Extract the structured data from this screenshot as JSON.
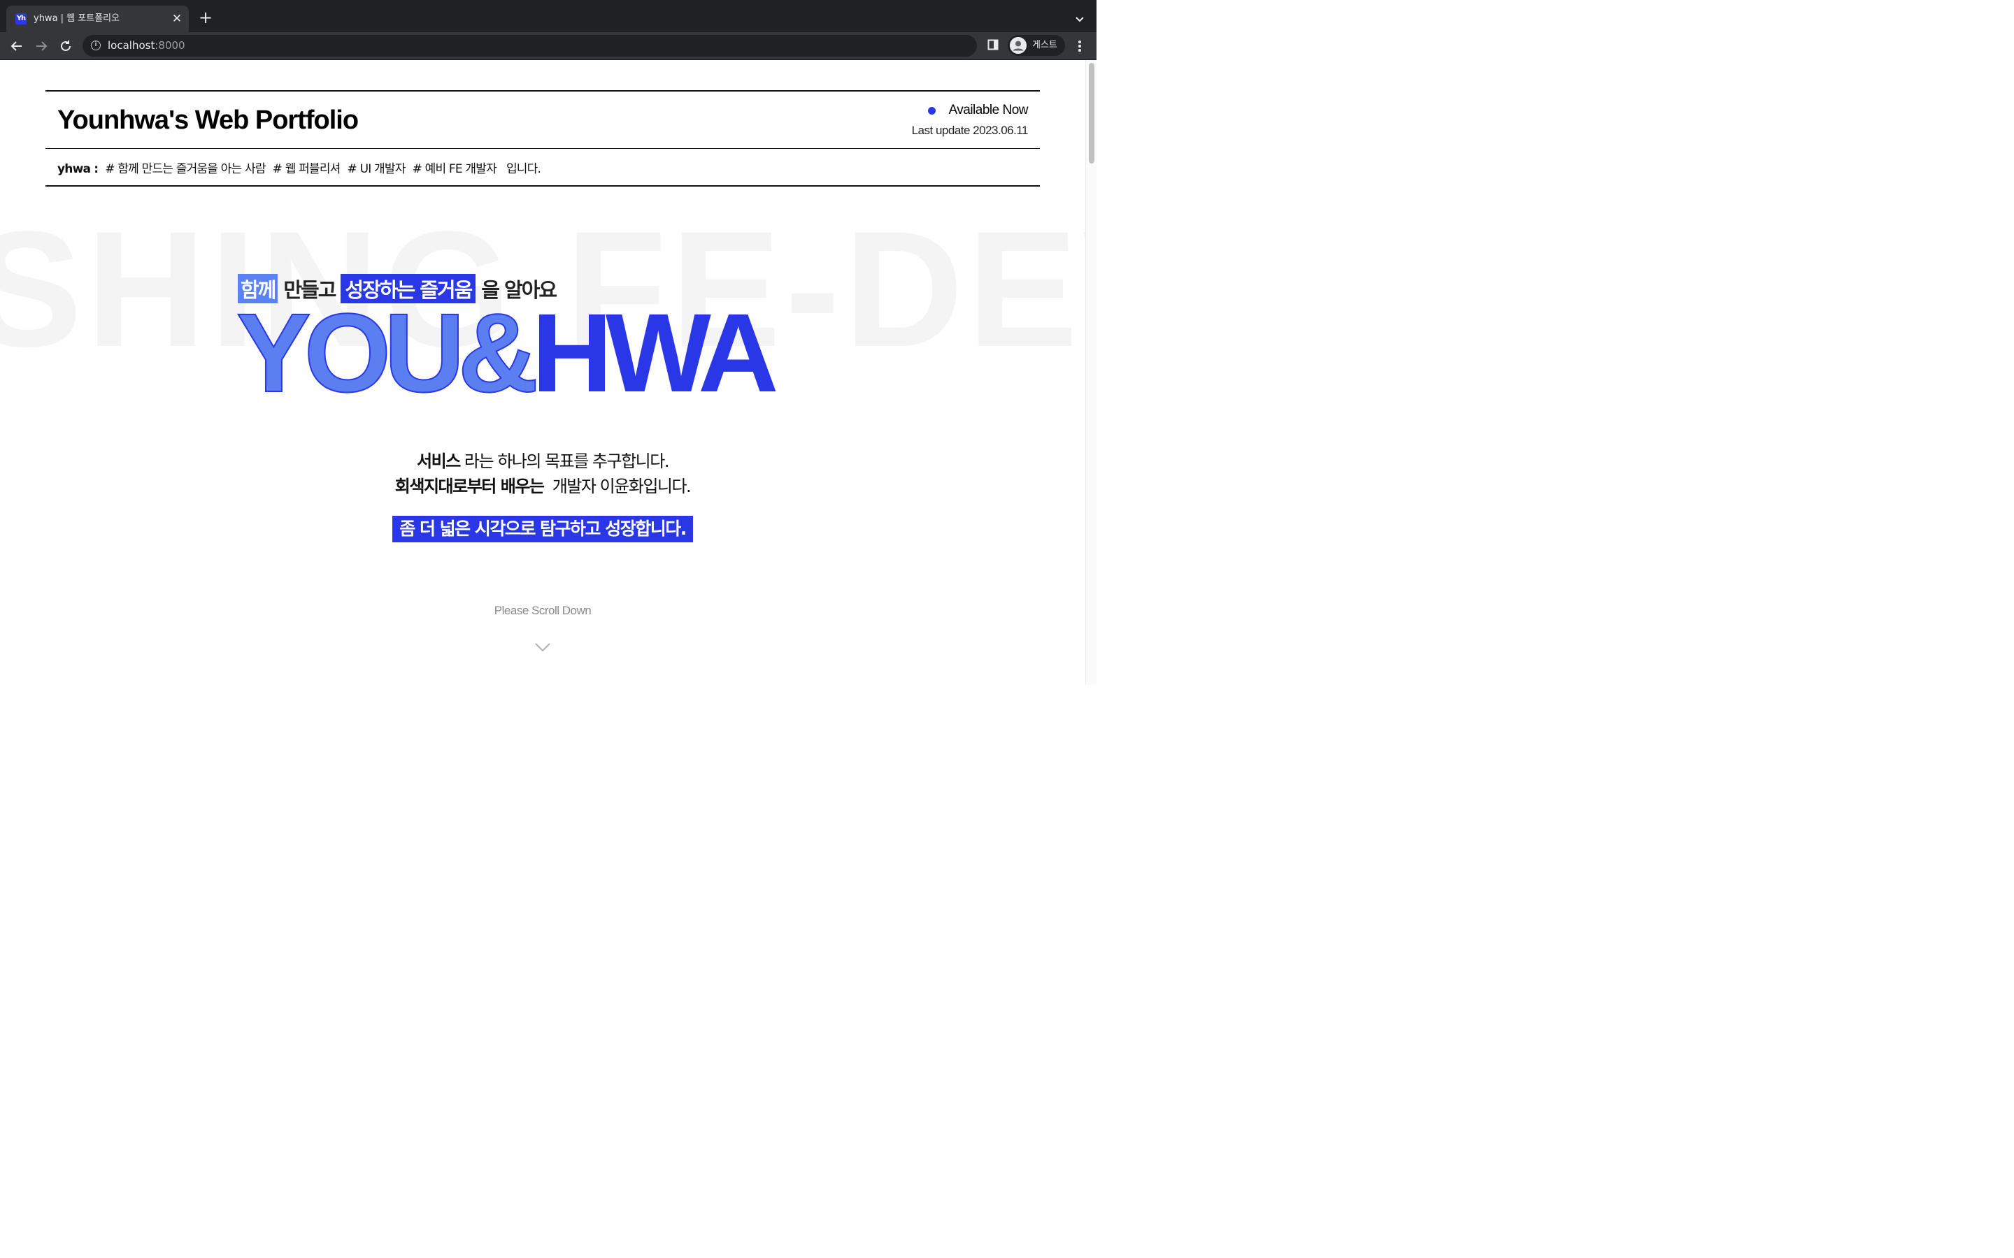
{
  "browser": {
    "tab": {
      "favicon_text": "Yh",
      "title": "yhwa | 웹 포트폴리오"
    },
    "address": {
      "host": "localhost",
      "port": ":8000"
    },
    "profile": {
      "name": "게스트"
    }
  },
  "header": {
    "title": "Younhwa's Web Portfolio",
    "status": "Available Now",
    "last_update": "Last update 2023.06.11"
  },
  "intro": {
    "name": "yhwa :",
    "tags": [
      "# 함께 만드는 즐거움을 아는 사람",
      "# 웹 퍼블리셔",
      "# UI 개발자",
      "# 예비 FE 개발자"
    ],
    "tail": "입니다."
  },
  "hero": {
    "background_word": "SHING FE-DEV",
    "tagline": {
      "part1": "함께",
      "part2": "만들고",
      "part3": "성장하는 즐거움",
      "part4": "을 알아요"
    },
    "title_left": "YOU&",
    "title_right": "HWA"
  },
  "mission": {
    "line1_bold": "서비스",
    "line1_rest": " 라는 하나의 목표를 추구합니다.",
    "line2_bold": "회색지대로부터 배우는",
    "line2_rest": "  개발자 이윤화입니다.",
    "callout": "좀 더 넓은 시각으로 탐구하고 성장합니다."
  },
  "scroll": {
    "hint": "Please Scroll Down"
  },
  "colors": {
    "accent": "#2a37e6",
    "accent_light": "#5b7ff0",
    "chrome_dark": "#202124",
    "chrome_toolbar": "#35363a"
  },
  "icons": [
    "back-icon",
    "forward-icon",
    "reload-icon",
    "info-icon",
    "side-panel-icon",
    "avatar-icon",
    "kebab-menu-icon",
    "chevron-down-icon",
    "close-icon",
    "plus-icon"
  ]
}
